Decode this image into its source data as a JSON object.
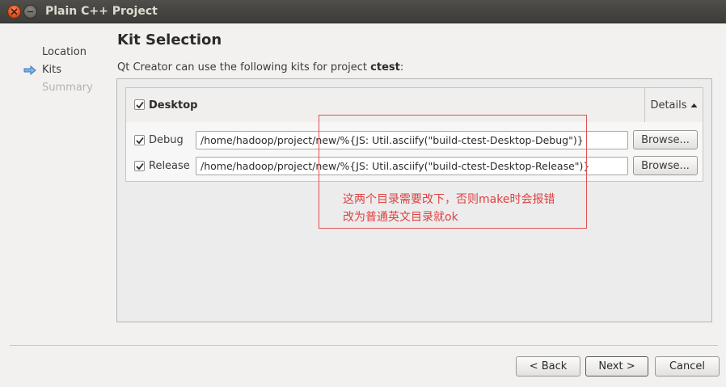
{
  "window": {
    "title": "Plain C++ Project"
  },
  "sidebar": {
    "items": [
      {
        "label": "Location"
      },
      {
        "label": "Kits"
      },
      {
        "label": "Summary"
      }
    ]
  },
  "page": {
    "heading": "Kit Selection",
    "intro_prefix": "Qt Creator can use the following kits for project ",
    "project_name": "ctest",
    "intro_suffix": ":"
  },
  "kit": {
    "name": "Desktop",
    "checked": true,
    "details_label": "Details",
    "builds": [
      {
        "label": "Debug",
        "checked": true,
        "path": "/home/hadoop/project/new/%{JS: Util.asciify(\"build-ctest-Desktop-Debug\")}",
        "browse_label": "Browse..."
      },
      {
        "label": "Release",
        "checked": true,
        "path": "/home/hadoop/project/new/%{JS: Util.asciify(\"build-ctest-Desktop-Release\")}",
        "browse_label": "Browse..."
      }
    ]
  },
  "annotation": {
    "line1": "这两个目录需要改下，否则make时会报错",
    "line2": "改为普通英文目录就ok",
    "color": "#e04040"
  },
  "footer": {
    "back_label": "< Back",
    "next_label": "Next >",
    "cancel_label": "Cancel"
  },
  "icons": {
    "sidebar_current": "right-arrow-icon",
    "window_close": "close-icon",
    "window_minimize": "minimize-icon",
    "details_toggle": "triangle-up-icon"
  },
  "colors": {
    "accent": "#4a90d9",
    "annotation_red": "#e04040"
  }
}
